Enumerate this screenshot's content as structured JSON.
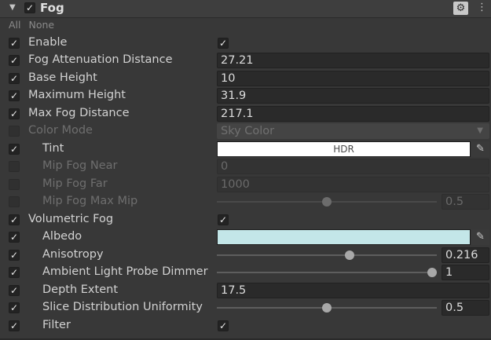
{
  "header": {
    "title": "Fog",
    "enabled_check": "✓",
    "fold_icon": "▼",
    "settings_icon": "⚙",
    "more_icon": "⋮"
  },
  "quick_toggles": {
    "all": "All",
    "none": "None"
  },
  "colors": {
    "background": "#383838",
    "tint": "#ffffff",
    "albedo": "#c3e6e8"
  },
  "rows": {
    "enable": {
      "label": "Enable",
      "override": "✓",
      "value": "✓"
    },
    "fog_attenuation_distance": {
      "label": "Fog Attenuation Distance",
      "override": "✓",
      "value": "27.21"
    },
    "base_height": {
      "label": "Base Height",
      "override": "✓",
      "value": "10"
    },
    "maximum_height": {
      "label": "Maximum Height",
      "override": "✓",
      "value": "31.9"
    },
    "max_fog_distance": {
      "label": "Max Fog Distance",
      "override": "✓",
      "value": "217.1"
    },
    "color_mode": {
      "label": "Color Mode",
      "override": "",
      "value": "Sky Color"
    },
    "tint": {
      "label": "Tint",
      "override": "✓",
      "value": "HDR"
    },
    "mip_fog_near": {
      "label": "Mip Fog Near",
      "override": "",
      "value": "0"
    },
    "mip_fog_far": {
      "label": "Mip Fog Far",
      "override": "",
      "value": "1000"
    },
    "mip_fog_max_mip": {
      "label": "Mip Fog Max Mip",
      "override": "",
      "value": "0.5",
      "slider_fraction": 0.5
    },
    "volumetric_fog": {
      "label": "Volumetric Fog",
      "override": "✓",
      "value": "✓"
    },
    "albedo": {
      "label": "Albedo",
      "override": "✓"
    },
    "anisotropy": {
      "label": "Anisotropy",
      "override": "✓",
      "value": "0.216",
      "slider_fraction": 0.608
    },
    "ambient_light_probe_dimmer": {
      "label": "Ambient Light Probe Dimmer",
      "override": "✓",
      "value": "1",
      "slider_fraction": 1.0
    },
    "depth_extent": {
      "label": "Depth Extent",
      "override": "✓",
      "value": "17.5"
    },
    "slice_distribution_uniformity": {
      "label": "Slice Distribution Uniformity",
      "override": "✓",
      "value": "0.5",
      "slider_fraction": 0.5
    },
    "filter": {
      "label": "Filter",
      "override": "✓",
      "value": "✓"
    }
  },
  "icons": {
    "dropdown_arrow": "▼",
    "eyedropper": "✎"
  }
}
